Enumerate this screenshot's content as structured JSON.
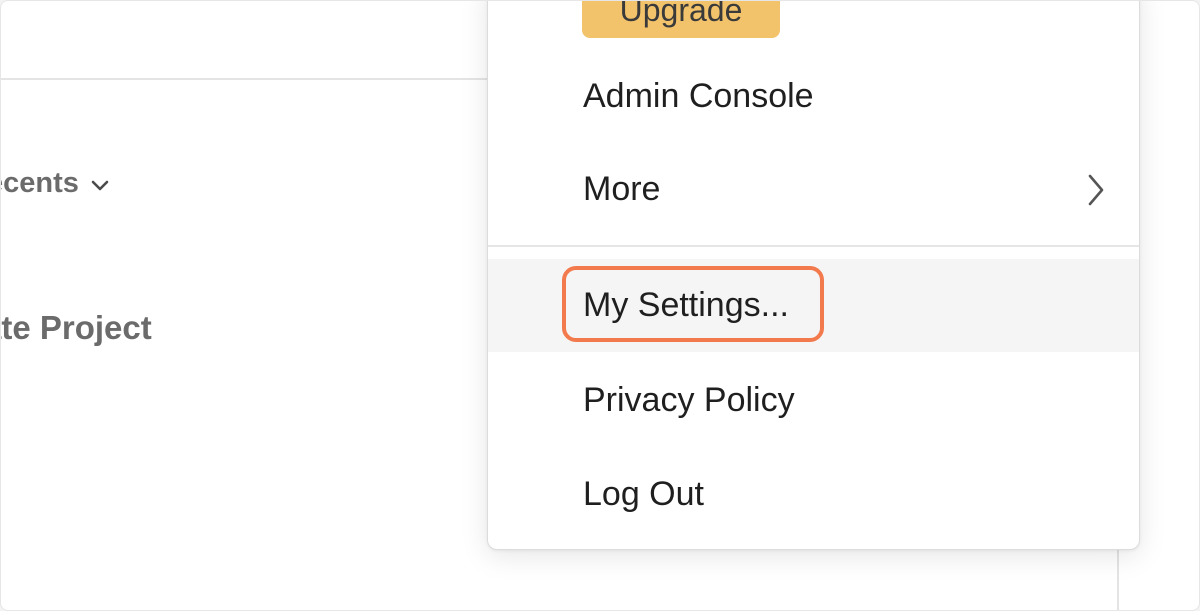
{
  "sidebar": {
    "recents_label": "ecents",
    "create_project_label": "ate Project"
  },
  "menu": {
    "upgrade_label": "Upgrade",
    "items": [
      {
        "label": "Admin Console"
      },
      {
        "label": "More",
        "icon": "chevron-right-icon"
      },
      {
        "label": "My Settings...",
        "state": "hovered"
      },
      {
        "label": "Privacy Policy"
      },
      {
        "label": "Log Out"
      }
    ]
  },
  "colors": {
    "upgrade_bg": "#f2c36b",
    "highlight": "#f27a4d",
    "hover_bg": "#f5f5f5",
    "muted_text": "#6b6b6b"
  }
}
